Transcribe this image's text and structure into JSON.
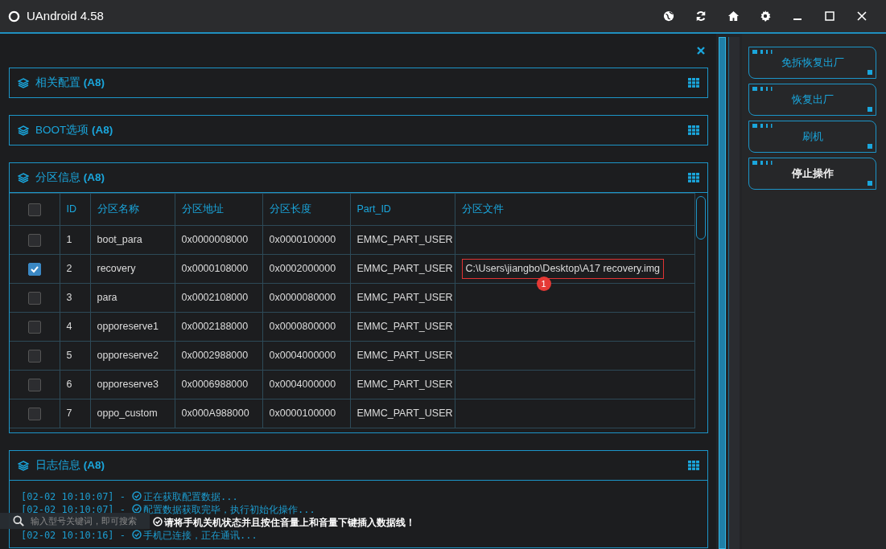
{
  "window": {
    "title": "UAndroid 4.58"
  },
  "sections": [
    {
      "title": "相关配置 **(A8)**"
    },
    {
      "title": "BOOT选项 **(A8)**"
    }
  ],
  "partition_section": {
    "title": "分区信息 **(A8)**",
    "table": {
      "all_checked": false,
      "columns": [
        "ID",
        "分区名称",
        "分区地址",
        "分区长度",
        "Part_ID",
        "分区文件"
      ],
      "rows": [
        {
          "checked": false,
          "cells": [
            "1",
            "boot_para",
            "0x0000008000",
            "0x0000100000",
            "EMMC_PART_USER",
            ""
          ]
        },
        {
          "checked": true,
          "cells": [
            "2",
            "recovery",
            "0x0000108000",
            "0x0002000000",
            "EMMC_PART_USER",
            "C:\\Users\\jiangbo\\Desktop\\A17 recovery.img"
          ],
          "annotation": "1"
        },
        {
          "checked": false,
          "cells": [
            "3",
            "para",
            "0x0002108000",
            "0x0000080000",
            "EMMC_PART_USER",
            ""
          ]
        },
        {
          "checked": false,
          "cells": [
            "4",
            "opporeserve1",
            "0x0002188000",
            "0x0000800000",
            "EMMC_PART_USER",
            ""
          ]
        },
        {
          "checked": false,
          "cells": [
            "5",
            "opporeserve2",
            "0x0002988000",
            "0x0004000000",
            "EMMC_PART_USER",
            ""
          ]
        },
        {
          "checked": false,
          "cells": [
            "6",
            "opporeserve3",
            "0x0006988000",
            "0x0004000000",
            "EMMC_PART_USER",
            ""
          ]
        },
        {
          "checked": false,
          "cells": [
            "7",
            "oppo_custom",
            "0x000A988000",
            "0x0000100000",
            "EMMC_PART_USER",
            ""
          ]
        }
      ]
    }
  },
  "log_section": {
    "title": "日志信息 **(A8)**",
    "lines": [
      {
        "time": "[02-02 10:10:07] -",
        "text": "正在获取配置数据...",
        "highlight": false
      },
      {
        "time": "[02-02 10:10:07] -",
        "text": "配置数据获取完毕，执行初始化操作...",
        "highlight": false
      },
      {
        "text": "请将手机关机状态并且按住音量上和音量下键插入数据线！",
        "highlight": true
      },
      {
        "time": "[02-02 10:10:16] -",
        "text": "手机已连接，正在通讯...",
        "highlight": false
      }
    ]
  },
  "search": {
    "placeholder": "输入型号关键词，即可搜索"
  },
  "actions": [
    {
      "label": "免拆恢复出厂",
      "emphasis": false
    },
    {
      "label": "恢复出厂",
      "emphasis": false
    },
    {
      "label": "刷机",
      "emphasis": false
    },
    {
      "label": "停止操作",
      "emphasis": true
    }
  ]
}
